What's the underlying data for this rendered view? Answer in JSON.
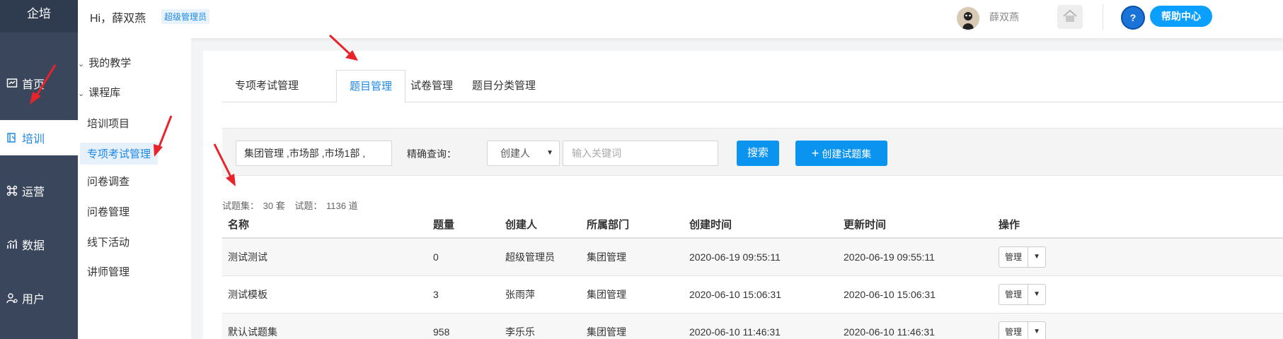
{
  "sidebar": {
    "brand": "企培",
    "items": [
      {
        "label": "首页",
        "icon": "dashboard-icon"
      },
      {
        "label": "培训",
        "icon": "book-icon",
        "active": true
      },
      {
        "label": "运营",
        "icon": "command-icon"
      },
      {
        "label": "数据",
        "icon": "bar-chart-icon"
      },
      {
        "label": "用户",
        "icon": "user-gear-icon"
      }
    ]
  },
  "header": {
    "greeting": "Hi，薛双燕",
    "role": "超级管理员",
    "username": "薛双燕",
    "help": "帮助中心",
    "help_q": "?"
  },
  "submenu": {
    "groups": [
      "我的教学",
      "课程库"
    ],
    "items": [
      "培训项目",
      "专项考试管理",
      "问卷调查",
      "问卷管理",
      "线下活动",
      "讲师管理"
    ],
    "active": "专项考试管理"
  },
  "tabs": [
    "专项考试管理",
    "题目管理",
    "试卷管理",
    "题目分类管理"
  ],
  "filter": {
    "dept_value": "集团管理 ,市场部 ,市场1部 ,",
    "exact_label": "精确查询：",
    "select_value": "创建人",
    "keyword_placeholder": "输入关键词",
    "search_label": "搜索",
    "create_label": "创建试题集",
    "create_icon": "+"
  },
  "stats": {
    "set_label": "试题集：",
    "set_count": "30 套",
    "q_label": "试题：",
    "q_count": "1136 道"
  },
  "table": {
    "headers": [
      "名称",
      "题量",
      "创建人",
      "所属部门",
      "创建时间",
      "更新时间",
      "操作"
    ],
    "rows": [
      {
        "name": "测试测试",
        "count": "0",
        "creator": "超级管理员",
        "dept": "集团管理",
        "created": "2020-06-19 09:55:11",
        "updated": "2020-06-19 09:55:11"
      },
      {
        "name": "测试模板",
        "count": "3",
        "creator": "张雨萍",
        "dept": "集团管理",
        "created": "2020-06-10 15:06:31",
        "updated": "2020-06-10 15:06:31"
      },
      {
        "name": "默认试题集",
        "count": "958",
        "creator": "李乐乐",
        "dept": "集团管理",
        "created": "2020-06-10 11:46:31",
        "updated": "2020-06-10 11:46:31"
      }
    ],
    "manage_label": "管理"
  },
  "colors": {
    "sidebar_bg": "#39465b",
    "accent": "#1e88e5",
    "button": "#0b93f0",
    "annotation": "#e8232a"
  }
}
